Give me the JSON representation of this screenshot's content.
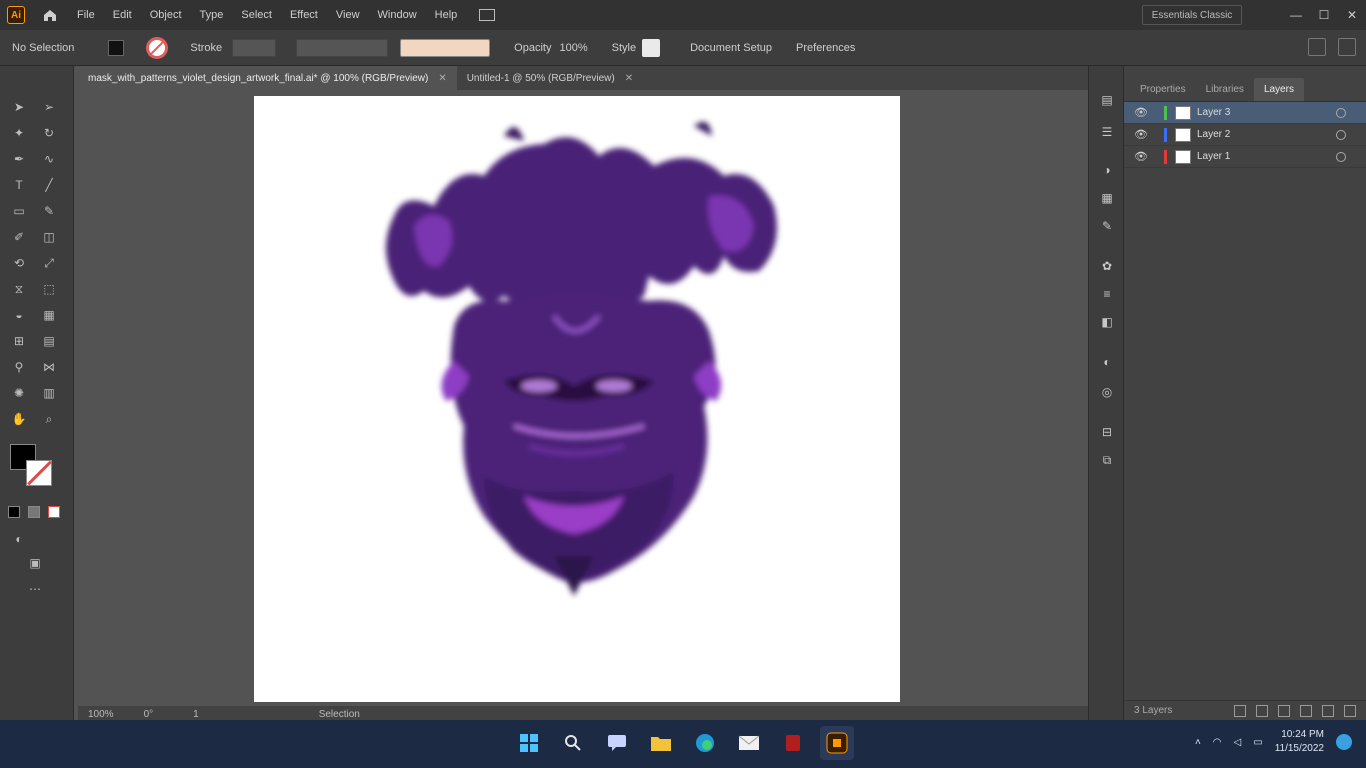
{
  "app": {
    "logo_text": "Ai"
  },
  "menu": {
    "items": [
      "File",
      "Edit",
      "Object",
      "Type",
      "Select",
      "Effect",
      "View",
      "Window",
      "Help"
    ],
    "share_label": "Essentials Classic"
  },
  "window_controls": {
    "minimize": "—",
    "maximize": "☐",
    "close": "✕"
  },
  "controlbar": {
    "selection_label": "No Selection",
    "stroke_label": "Stroke",
    "opacity_label": "Opacity",
    "opacity_value": "100%",
    "style_label": "Style",
    "doc_setup_label": "Document Setup",
    "preferences_label": "Preferences"
  },
  "tabs": [
    {
      "label": "mask_with_patterns_violet_design_artwork_final.ai* @ 100% (RGB/Preview)",
      "close": "✕",
      "active": true
    },
    {
      "label": "Untitled-1 @ 50% (RGB/Preview)",
      "close": "✕",
      "active": false
    }
  ],
  "status": {
    "zoom": "100%",
    "rotation": "0°",
    "artboard_nav": "1",
    "tool": "Selection"
  },
  "panel": {
    "tabs": [
      "Properties",
      "Libraries",
      "Layers"
    ],
    "active_tab": "Layers",
    "layers": [
      {
        "name": "Layer 3",
        "color": "#4fbf4f",
        "selected": true
      },
      {
        "name": "Layer 2",
        "color": "#3a6ff0",
        "selected": false
      },
      {
        "name": "Layer 1",
        "color": "#e03a3a",
        "selected": false
      }
    ],
    "footer_count": "3 Layers"
  },
  "taskbar": {
    "time": "10:24 PM",
    "date": "11/15/2022",
    "icons": [
      "start-icon",
      "search-icon",
      "chat-icon",
      "explorer-icon",
      "edge-icon",
      "mail-icon",
      "office-icon",
      "illustrator-icon"
    ]
  },
  "colors": {
    "accent": "#ff9a00",
    "art_purple": "#5b2a8a",
    "art_magenta": "#9a3cc7"
  }
}
